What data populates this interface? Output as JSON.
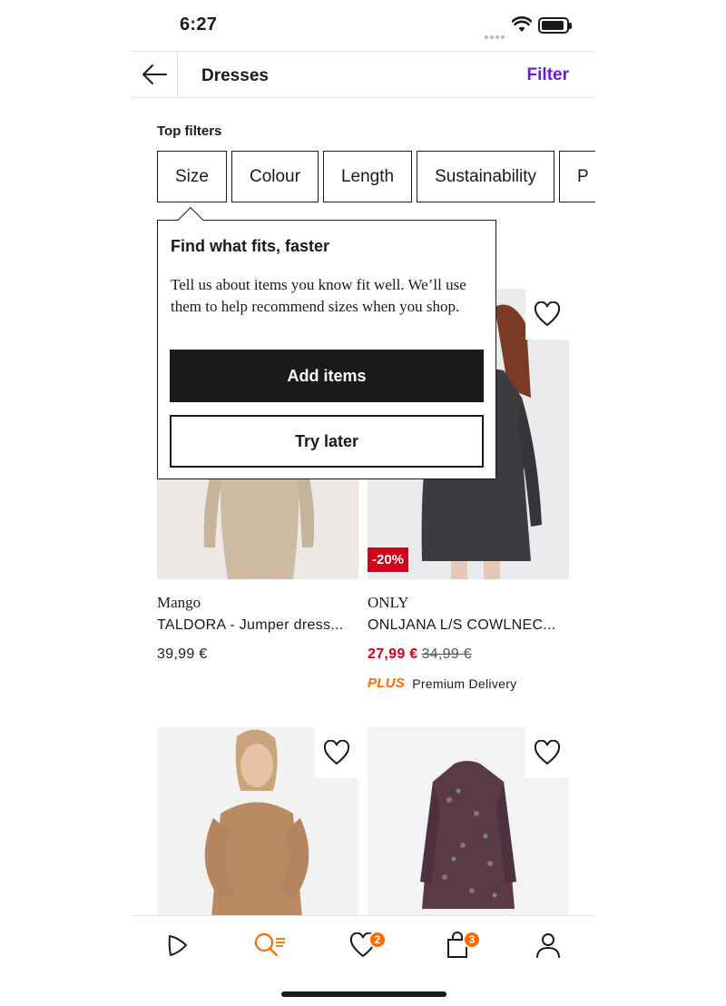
{
  "status_bar": {
    "time": "6:27"
  },
  "header": {
    "title": "Dresses",
    "filter_label": "Filter"
  },
  "top_filters": {
    "label": "Top filters",
    "chips": [
      "Size",
      "Colour",
      "Length",
      "Sustainability",
      "P"
    ]
  },
  "popover": {
    "title": "Find what fits, faster",
    "body": "Tell us about items you know fit well. We’ll use them to help recommend sizes when you shop.",
    "primary_label": "Add items",
    "secondary_label": "Try later"
  },
  "products": [
    {
      "brand": "Mango",
      "name": "TALDORA - Jumper dress...",
      "price": "39,99 €"
    },
    {
      "brand": "ONLY",
      "name": "ONLJANA L/S COWLNEC...",
      "sale_price": "27,99 €",
      "old_price": "34,99 €",
      "discount": "-20%",
      "plus_label": "PLUS",
      "delivery": "Premium Delivery"
    },
    {
      "brand": "",
      "name": ""
    },
    {
      "brand": "",
      "name": ""
    }
  ],
  "tabbar": {
    "wishlist_count": "2",
    "bag_count": "3"
  },
  "colors": {
    "accent": "#6a1bd6",
    "orange": "#ff6900",
    "sale": "#d5001c"
  },
  "icons": [
    "back-arrow-icon",
    "wifi-icon",
    "battery-icon",
    "heart-icon",
    "home-icon",
    "search-icon",
    "bag-icon",
    "profile-icon"
  ]
}
